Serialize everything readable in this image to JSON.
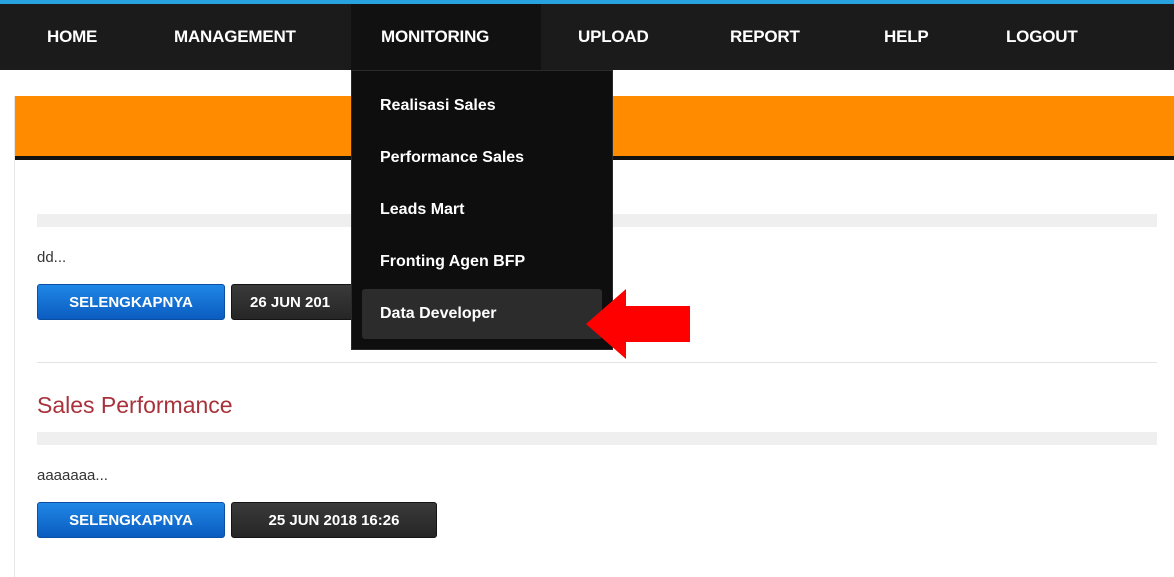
{
  "nav": {
    "items": [
      {
        "label": "HOME"
      },
      {
        "label": "MANAGEMENT"
      },
      {
        "label": "MONITORING"
      },
      {
        "label": "UPLOAD"
      },
      {
        "label": "REPORT"
      },
      {
        "label": "HELP"
      },
      {
        "label": "LOGOUT"
      }
    ],
    "active": "MONITORING"
  },
  "dropdown": {
    "items": [
      {
        "label": "Realisasi Sales"
      },
      {
        "label": "Performance Sales"
      },
      {
        "label": "Leads Mart"
      },
      {
        "label": "Fronting Agen BFP"
      },
      {
        "label": "Data Developer"
      }
    ],
    "highlighted": "Data Developer"
  },
  "posts": [
    {
      "excerpt": "dd...",
      "button_label": "SELENGKAPNYA",
      "date": "26 JUN 201"
    },
    {
      "title": "Sales Performance",
      "excerpt": "aaaaaaa...",
      "button_label": "SELENGKAPNYA",
      "date": "25 JUN 2018 16:26"
    }
  ],
  "colors": {
    "topbar": "#1b1b1b",
    "topbar_accent": "#29a3e0",
    "banner": "#ff8c00",
    "button_primary": "#0b5cc0",
    "title": "#a8323b",
    "arrow": "#ff0000"
  },
  "annotation": {
    "icon": "red-arrow-icon"
  }
}
